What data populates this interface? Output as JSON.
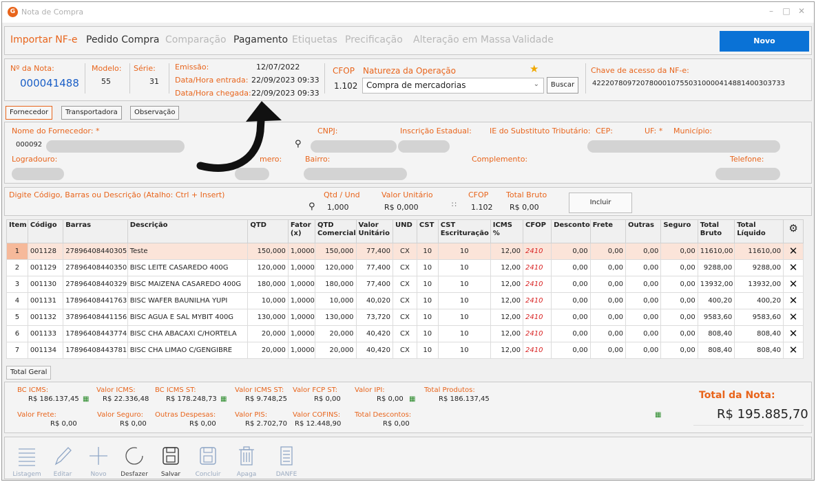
{
  "window": {
    "title": "Nota de Compra",
    "logo_letter": "G"
  },
  "menu": {
    "items": [
      {
        "label": "Importar NF-e",
        "style": "orange"
      },
      {
        "label": "Pedido Compra",
        "style": "dark"
      },
      {
        "label": "Comparação",
        "style": "gray"
      },
      {
        "label": "Pagamento",
        "style": "dark"
      },
      {
        "label": "Etiquetas",
        "style": "gray"
      },
      {
        "label": "Precificação",
        "style": "gray"
      },
      {
        "label": "Alteração em Massa",
        "style": "gray"
      },
      {
        "label": "Validade",
        "style": "gray"
      }
    ],
    "novo_label": "Novo"
  },
  "header": {
    "nota_label": "Nº da Nota:",
    "nota_value": "000041488",
    "modelo_label": "Modelo:",
    "modelo_value": "55",
    "serie_label": "Série:",
    "serie_value": "31",
    "emissao_label": "Emissão:",
    "emissao_value": "12/07/2022",
    "entrada_label": "Data/Hora entrada:",
    "entrada_value": "22/09/2023 09:33",
    "chegada_label": "Data/Hora chegada:",
    "chegada_value": "22/09/2023 09:33",
    "cfop_label": "CFOP",
    "cfop_value": "1.102",
    "natureza_label": "Natureza da Operação",
    "natureza_value": "Compra de mercadorias",
    "buscar_label": "Buscar",
    "chave_label": "Chave de acesso da NF-e:",
    "chave_value": "42220780972078000107550310000414881400303733"
  },
  "tabs": {
    "fornecedor": "Fornecedor",
    "transportadora": "Transportadora",
    "observacao": "Observação"
  },
  "fornecedor": {
    "nome_label": "Nome do Fornecedor: *",
    "codigo": "000092",
    "cnpj_label": "CNPJ:",
    "ie_label": "Inscrição Estadual:",
    "ie_subst_label": "IE do Substituto Tributário:",
    "cep_label": "CEP:",
    "uf_label": "UF: *",
    "municipio_label": "Município:",
    "logradouro_label": "Logradouro:",
    "numero_label": "mero:",
    "bairro_label": "Bairro:",
    "complemento_label": "Complemento:",
    "telefone_label": "Telefone:"
  },
  "item_entry": {
    "codigo_label": "Digite Código, Barras ou Descrição (Atalho: Ctrl + Insert)",
    "qtd_label": "Qtd / Und",
    "qtd_value": "1,000",
    "valor_label": "Valor Unitário",
    "valor_value": "R$ 0,000",
    "cfop_label": "CFOP",
    "cfop_value": "1.102",
    "total_label": "Total Bruto",
    "total_value": "R$ 0,00",
    "incluir_label": "Incluir"
  },
  "grid": {
    "columns": [
      "Item",
      "Código",
      "Barras",
      "Descrição",
      "QTD",
      "Fator (x)",
      "QTD Comercial",
      "Valor Unitário",
      "UND",
      "CST",
      "CST Escrituração",
      "ICMS %",
      "CFOP",
      "Desconto",
      "Frete",
      "Outras",
      "Seguro",
      "Total Bruto",
      "Total Líquido"
    ],
    "rows": [
      [
        "1",
        "001128",
        "27896408440305",
        "Teste",
        "150,000",
        "1,0000",
        "150,000",
        "77,400",
        "CX",
        "10",
        "10",
        "12,00",
        "2410",
        "0,00",
        "0,00",
        "0,00",
        "0,00",
        "11610,00",
        "11610,00"
      ],
      [
        "2",
        "001129",
        "27896408440350",
        "BISC LEITE CASAREDO 400G",
        "120,000",
        "1,0000",
        "120,000",
        "77,400",
        "CX",
        "10",
        "10",
        "12,00",
        "2410",
        "0,00",
        "0,00",
        "0,00",
        "0,00",
        "9288,00",
        "9288,00"
      ],
      [
        "3",
        "001130",
        "27896408440329",
        "BISC MAIZENA CASAREDO 400G",
        "180,000",
        "1,0000",
        "180,000",
        "77,400",
        "CX",
        "10",
        "10",
        "12,00",
        "2410",
        "0,00",
        "0,00",
        "0,00",
        "0,00",
        "13932,00",
        "13932,00"
      ],
      [
        "4",
        "001131",
        "17896408441763",
        "BISC WAFER BAUNILHA YUPI",
        "10,000",
        "1,0000",
        "10,000",
        "40,020",
        "CX",
        "10",
        "10",
        "12,00",
        "2410",
        "0,00",
        "0,00",
        "0,00",
        "0,00",
        "400,20",
        "400,20"
      ],
      [
        "5",
        "001132",
        "37896408441156",
        "BISC AGUA E SAL MYBIT 400G",
        "130,000",
        "1,0000",
        "130,000",
        "73,720",
        "CX",
        "10",
        "10",
        "12,00",
        "2410",
        "0,00",
        "0,00",
        "0,00",
        "0,00",
        "9583,60",
        "9583,60"
      ],
      [
        "6",
        "001133",
        "17896408443774",
        "BISC CHA ABACAXI C/HORTELA",
        "20,000",
        "1,0000",
        "20,000",
        "40,420",
        "CX",
        "10",
        "10",
        "12,00",
        "2410",
        "0,00",
        "0,00",
        "0,00",
        "0,00",
        "808,40",
        "808,40"
      ],
      [
        "7",
        "001134",
        "17896408443781",
        "BISC CHA LIMAO C/GENGIBRE",
        "20,000",
        "1,0000",
        "20,000",
        "40,420",
        "CX",
        "10",
        "10",
        "12,00",
        "2410",
        "0,00",
        "0,00",
        "0,00",
        "0,00",
        "808,40",
        "808,40"
      ]
    ]
  },
  "totals": {
    "tab_label": "Total Geral",
    "bc_icms_label": "BC ICMS:",
    "bc_icms": "R$ 186.137,45",
    "valor_icms_label": "Valor ICMS:",
    "valor_icms": "R$ 22.336,48",
    "bc_icms_st_label": "BC ICMS ST:",
    "bc_icms_st": "R$ 178.248,73",
    "valor_icms_st_label": "Valor ICMS ST:",
    "valor_icms_st": "R$ 9.748,25",
    "valor_fcp_st_label": "Valor FCP ST:",
    "valor_fcp_st": "R$ 0,00",
    "valor_ipi_label": "Valor IPI:",
    "valor_ipi": "R$ 0,00",
    "total_produtos_label": "Total Produtos:",
    "total_produtos": "R$ 186.137,45",
    "valor_frete_label": "Valor Frete:",
    "valor_frete": "R$ 0,00",
    "valor_seguro_label": "Valor Seguro:",
    "valor_seguro": "R$ 0,00",
    "outras_label": "Outras Despesas:",
    "outras": "R$ 0,00",
    "valor_pis_label": "Valor PIS:",
    "valor_pis": "R$ 2.702,70",
    "valor_cofins_label": "Valor COFINS:",
    "valor_cofins": "R$ 12.448,90",
    "total_descontos_label": "Total Descontos:",
    "total_descontos": "R$ 0,00",
    "total_nota_label": "Total da Nota:",
    "total_nota": "R$ 195.885,70"
  },
  "toolbar": {
    "listagem": "Listagem",
    "editar": "Editar",
    "novo": "Novo",
    "desfazer": "Desfazer",
    "salvar": "Salvar",
    "concluir": "Concluir",
    "apaga": "Apaga",
    "danfe": "DANFE"
  },
  "colors": {
    "accent": "#e8641b",
    "primary_button": "#0a72d6",
    "cfop_red": "#d82020"
  }
}
